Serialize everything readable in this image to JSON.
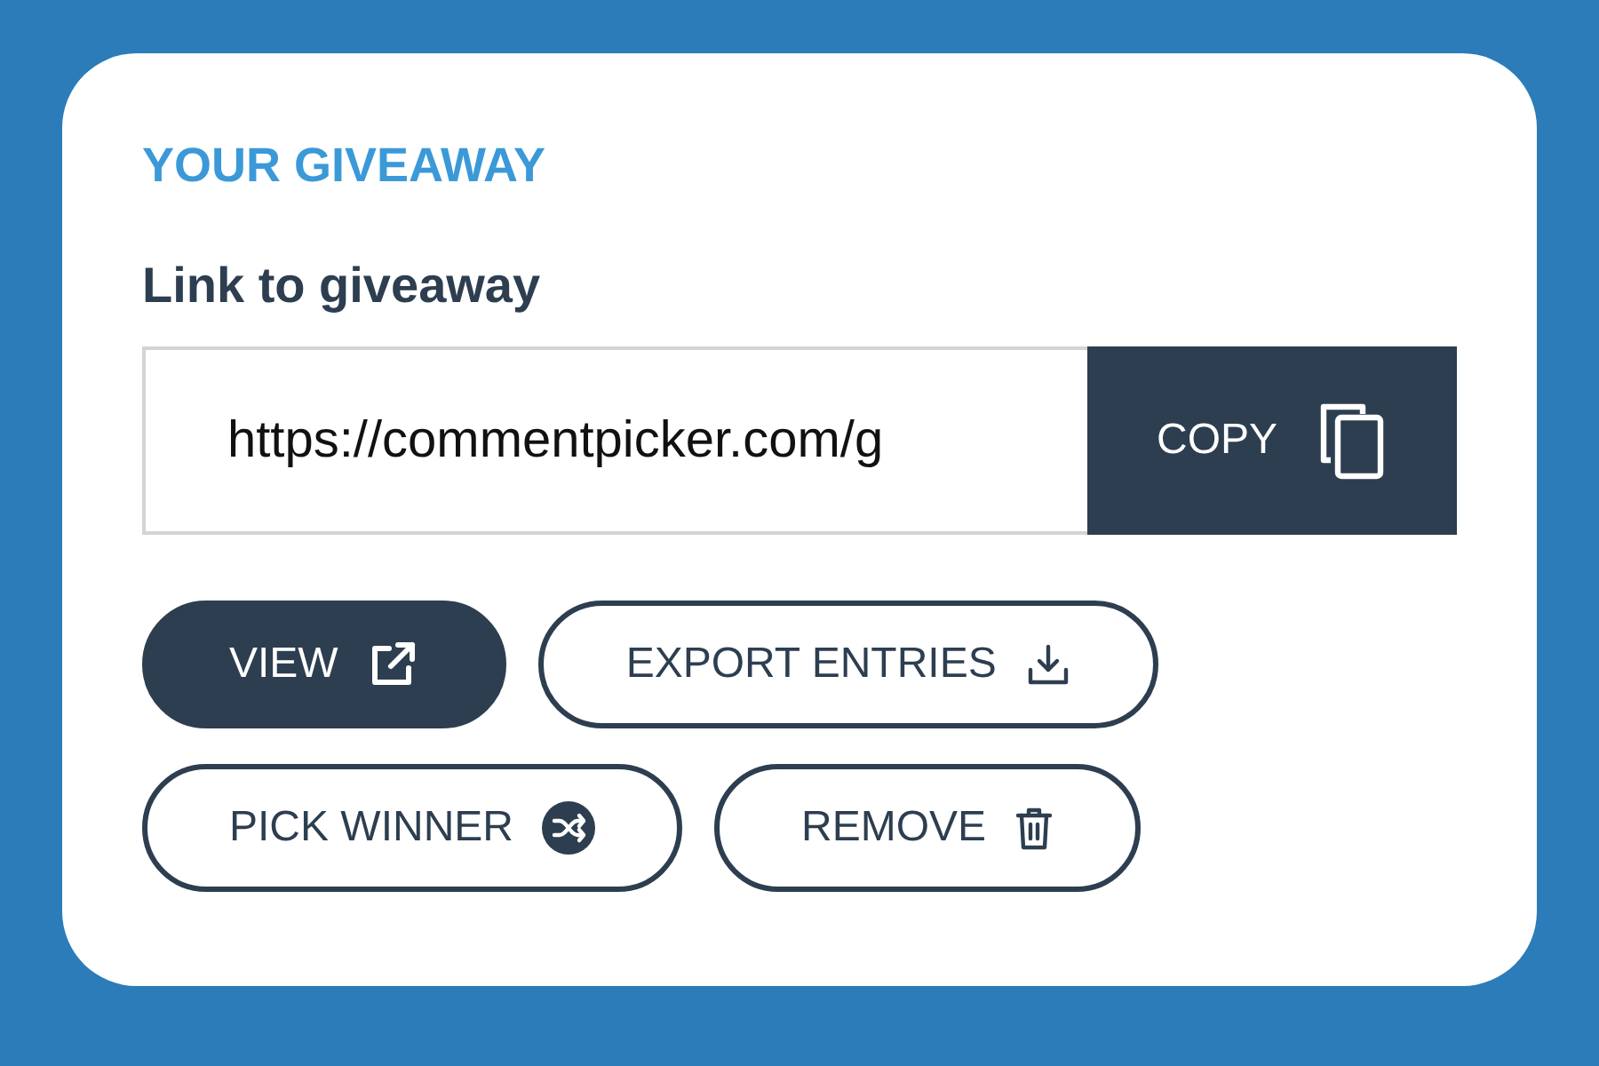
{
  "heading": "YOUR GIVEAWAY",
  "link": {
    "label": "Link to giveaway",
    "value": "https://commentpicker.com/g",
    "button": "COPY"
  },
  "actions": [
    {
      "label": "VIEW",
      "filled": true
    },
    {
      "label": "EXPORT ENTRIES",
      "filled": false
    },
    {
      "label": "PICK WINNER",
      "filled": false
    },
    {
      "label": "REMOVE",
      "filled": false
    }
  ]
}
